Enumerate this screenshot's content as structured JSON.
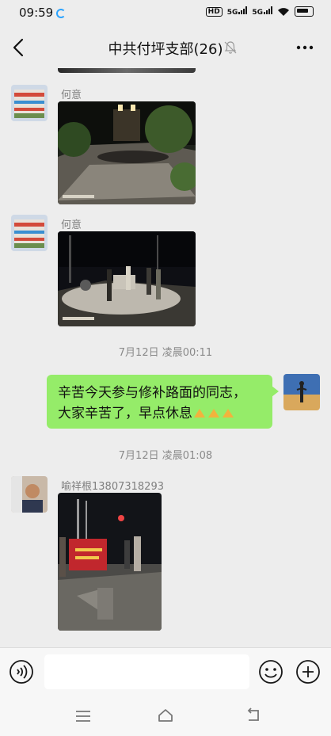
{
  "status_bar": {
    "time": "09:59",
    "network_hd": "HD",
    "network_1": "5G",
    "network_2": "5G"
  },
  "header": {
    "title": "中共付坪支部(26)",
    "muted": true
  },
  "messages": [
    {
      "type": "image",
      "sender": "何意",
      "content": "night road repair photo, paving machine"
    },
    {
      "type": "image",
      "sender": "何意",
      "content": "night photo, workers and vehicles on road"
    },
    {
      "type": "timestamp",
      "text": "7月12日 凌晨00:11"
    },
    {
      "type": "text",
      "outgoing": true,
      "line1": "辛苦今天参与修补路面的同志，",
      "line2": "大家辛苦了，早点休息"
    },
    {
      "type": "timestamp",
      "text": "7月12日 凌晨01:08"
    },
    {
      "type": "image",
      "sender": "喻祥根13807318293",
      "content": "night photo, group holding red banner"
    }
  ],
  "colors": {
    "bubble_outgoing": "#95ec69",
    "background": "#ededed"
  },
  "icons": [
    "back-arrow-icon",
    "mute-bell-icon",
    "more-dots-icon",
    "voice-icon",
    "emoji-icon",
    "plus-icon",
    "menu-icon",
    "home-icon",
    "back-icon"
  ]
}
